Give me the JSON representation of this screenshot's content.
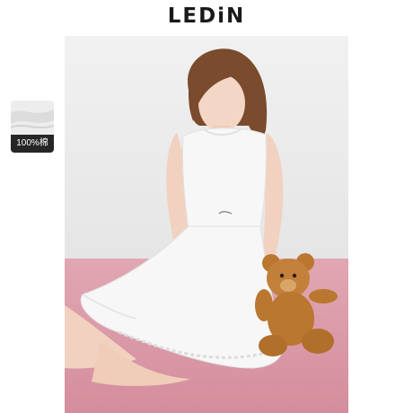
{
  "brand": {
    "logo_text": "LEDiN"
  },
  "badge": {
    "label": "100%棉",
    "swatch_icon": "fabric-swatch-icon"
  },
  "colors": {
    "background": "#ffffff",
    "wall": "#ececec",
    "carpet": "#d99aa8",
    "dress": "#f7f7f7",
    "bear": "#b9772f",
    "badge_label_bg": "#262626"
  }
}
